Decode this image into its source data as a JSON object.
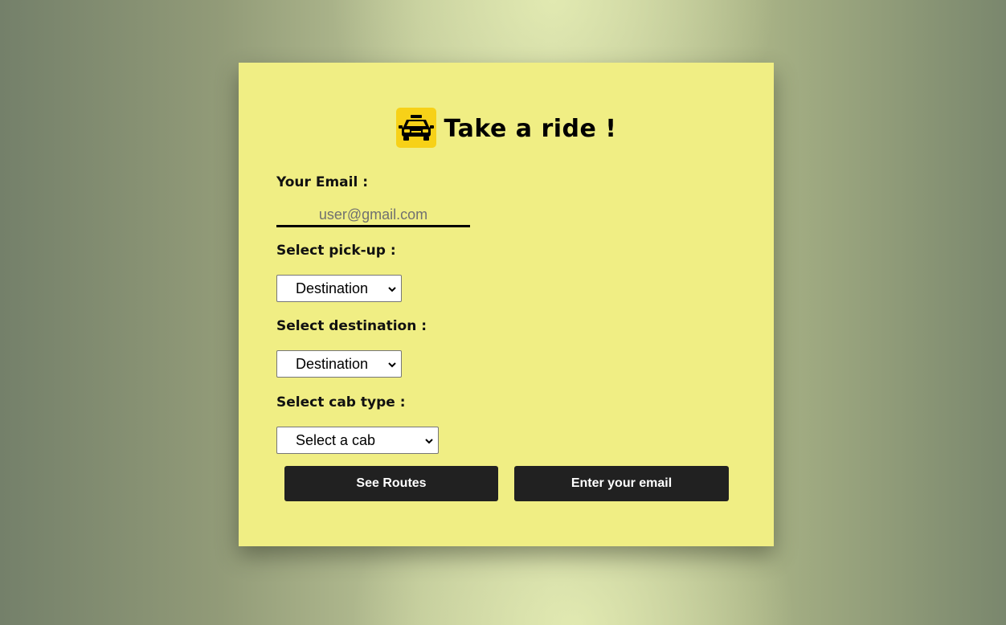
{
  "header": {
    "title": "Take a ride !",
    "logo_icon": "taxi-icon",
    "logo_color": "#f7d118"
  },
  "form": {
    "email_label": "Your Email :",
    "email_placeholder": "user@gmail.com",
    "email_value": "",
    "pickup_label": "Select pick-up :",
    "pickup_selected": "Destination",
    "destination_label": "Select destination :",
    "destination_selected": "Destination",
    "cab_label": "Select cab type :",
    "cab_selected": "Select a cab"
  },
  "buttons": {
    "see_routes": "See Routes",
    "enter_email": "Enter your email"
  },
  "colors": {
    "card_background": "#f0ee84",
    "button_background": "#212121"
  }
}
